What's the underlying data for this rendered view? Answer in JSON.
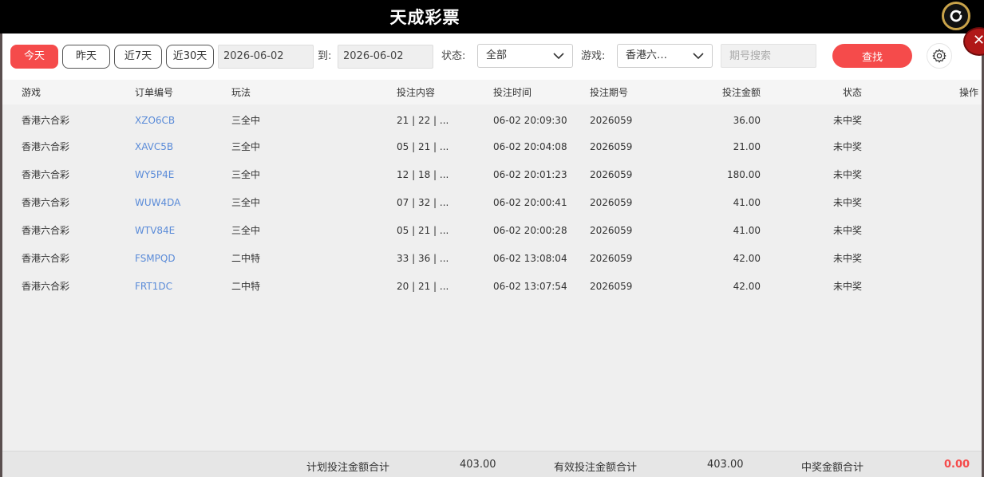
{
  "app": {
    "title": "天成彩票"
  },
  "filters": {
    "quick_ranges": [
      "今天",
      "昨天",
      "近7天",
      "近30天"
    ],
    "date_from": "2026-06-02",
    "to_label": "到:",
    "date_to": "2026-06-02",
    "status_label": "状态:",
    "status_value": "全部",
    "game_label": "游戏:",
    "game_value": "香港六…",
    "issue_placeholder": "期号搜索",
    "search_label": "查找"
  },
  "table": {
    "headers": [
      "游戏",
      "订单编号",
      "玩法",
      "投注内容",
      "投注时间",
      "投注期号",
      "投注金额",
      "状态",
      "操作"
    ],
    "rows": [
      [
        "香港六合彩",
        "XZO6CB",
        "三全中",
        "21 | 22 | ...",
        "06-02 20:09:30",
        "2026059",
        "36.00",
        "未中奖",
        ""
      ],
      [
        "香港六合彩",
        "XAVC5B",
        "三全中",
        "05 | 21 | ...",
        "06-02 20:04:08",
        "2026059",
        "21.00",
        "未中奖",
        ""
      ],
      [
        "香港六合彩",
        "WY5P4E",
        "三全中",
        "12 | 18 | ...",
        "06-02 20:01:23",
        "2026059",
        "180.00",
        "未中奖",
        ""
      ],
      [
        "香港六合彩",
        "WUW4DA",
        "三全中",
        "07 | 32 | ...",
        "06-02 20:00:41",
        "2026059",
        "41.00",
        "未中奖",
        ""
      ],
      [
        "香港六合彩",
        "WTV84E",
        "三全中",
        "05 | 21 | ...",
        "06-02 20:00:28",
        "2026059",
        "41.00",
        "未中奖",
        ""
      ],
      [
        "香港六合彩",
        "FSMPQD",
        "二中特",
        "33 | 36 | ...",
        "06-02 13:08:04",
        "2026059",
        "42.00",
        "未中奖",
        ""
      ],
      [
        "香港六合彩",
        "FRT1DC",
        "二中特",
        "20 | 21 | ...",
        "06-02 13:07:54",
        "2026059",
        "42.00",
        "未中奖",
        ""
      ]
    ]
  },
  "footer": {
    "planned_label": "计划投注金额合计",
    "planned_value": "403.00",
    "effective_label": "有效投注金额合计",
    "effective_value": "403.00",
    "win_label": "中奖金额合计",
    "win_value": "0.00"
  },
  "colors": {
    "accent": "#f54b4b",
    "link": "#5a8bd8",
    "header_bg": "#000000"
  },
  "icons": {
    "refresh": "refresh-icon",
    "settings": "gear-icon",
    "close": "close-icon",
    "dropdown": "chevron-down-icon"
  }
}
